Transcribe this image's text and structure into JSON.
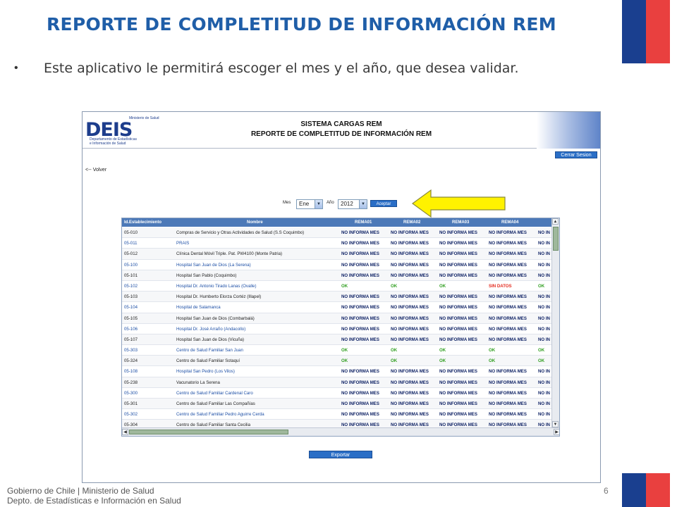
{
  "slide": {
    "title": "REPORTE DE COMPLETITUD DE INFORMACIÓN REM",
    "bullet": "Este aplicativo le permitirá escoger el mes y  el año, que desea validar.",
    "footer_line1": "Gobierno de Chile | Ministerio de Salud",
    "footer_line2": "Depto. de Estadísticas e Información en Salud",
    "page_number": "6",
    "colors": {
      "title": "#1f5ea8",
      "flag_blue": "#1a3f8f",
      "flag_red": "#e9403f"
    }
  },
  "app": {
    "logo": {
      "wordmark": "DEIS",
      "ministry": "Ministerio de Salud",
      "dept_line1": "Departamento de Estadísticas",
      "dept_line2": "e Información de Salud"
    },
    "header_line1": "SISTEMA CARGAS REM",
    "header_line2": "REPORTE DE COMPLETITUD DE INFORMACIÓN REM",
    "logout_label": "Cerrar Sesion",
    "back_label": "<-- Volver",
    "filters": {
      "month_label": "Mes",
      "month_value": "Ene",
      "year_label": "Año",
      "year_value": "2012",
      "accept_label": "Aceptar"
    },
    "table": {
      "columns": [
        "Id.Establecimiento",
        "Nombre",
        "REMA01",
        "REMA02",
        "REMA03",
        "REMA04"
      ],
      "rows": [
        {
          "id": "05-010",
          "name": "Compras de Servicio y Otras Actividades de Salud (S.S Coquimbo)",
          "r1": "NO INFORMA MES",
          "r2": "NO INFORMA MES",
          "r3": "NO INFORMA MES",
          "r4": "NO INFORMA MES",
          "r5": "NO IN"
        },
        {
          "id": "05-011",
          "name": "PRAIS",
          "r1": "NO INFORMA MES",
          "r2": "NO INFORMA MES",
          "r3": "NO INFORMA MES",
          "r4": "NO INFORMA MES",
          "r5": "NO IN"
        },
        {
          "id": "05-012",
          "name": "Clínica Dental Móvil Triple. Pat. PW4100 (Monte Patria)",
          "r1": "NO INFORMA MES",
          "r2": "NO INFORMA MES",
          "r3": "NO INFORMA MES",
          "r4": "NO INFORMA MES",
          "r5": "NO IN"
        },
        {
          "id": "05-100",
          "name": "Hospital San Juan de Dios (La Serena)",
          "r1": "NO INFORMA MES",
          "r2": "NO INFORMA MES",
          "r3": "NO INFORMA MES",
          "r4": "NO INFORMA MES",
          "r5": "NO IN"
        },
        {
          "id": "05-101",
          "name": "Hospital San Pablo (Coquimbo)",
          "r1": "NO INFORMA MES",
          "r2": "NO INFORMA MES",
          "r3": "NO INFORMA MES",
          "r4": "NO INFORMA MES",
          "r5": "NO IN"
        },
        {
          "id": "05-102",
          "name": "Hospital Dr. Antonio Tirado Lanas (Ovalle)",
          "r1": "OK",
          "r2": "OK",
          "r3": "OK",
          "r4": "SIN DATOS",
          "r5": "OK"
        },
        {
          "id": "05-103",
          "name": "Hospital Dr. Humberto Elorza Cortéz (Illapel)",
          "r1": "NO INFORMA MES",
          "r2": "NO INFORMA MES",
          "r3": "NO INFORMA MES",
          "r4": "NO INFORMA MES",
          "r5": "NO IN"
        },
        {
          "id": "05-104",
          "name": "Hospital de Salamanca",
          "r1": "NO INFORMA MES",
          "r2": "NO INFORMA MES",
          "r3": "NO INFORMA MES",
          "r4": "NO INFORMA MES",
          "r5": "NO IN"
        },
        {
          "id": "05-105",
          "name": "Hospital San Juan de Dios (Combarbalá)",
          "r1": "NO INFORMA MES",
          "r2": "NO INFORMA MES",
          "r3": "NO INFORMA MES",
          "r4": "NO INFORMA MES",
          "r5": "NO IN"
        },
        {
          "id": "05-106",
          "name": "Hospital Dr. José Arraño (Andacollo)",
          "r1": "NO INFORMA MES",
          "r2": "NO INFORMA MES",
          "r3": "NO INFORMA MES",
          "r4": "NO INFORMA MES",
          "r5": "NO IN"
        },
        {
          "id": "05-107",
          "name": "Hospital San Juan de Dios (Vicuña)",
          "r1": "NO INFORMA MES",
          "r2": "NO INFORMA MES",
          "r3": "NO INFORMA MES",
          "r4": "NO INFORMA MES",
          "r5": "NO IN"
        },
        {
          "id": "05-303",
          "name": "Centro de Salud Familiar San Juan",
          "r1": "OK",
          "r2": "OK",
          "r3": "OK",
          "r4": "OK",
          "r5": "OK"
        },
        {
          "id": "05-324",
          "name": "Centro de Salud Familiar Sotaquí",
          "r1": "OK",
          "r2": "OK",
          "r3": "OK",
          "r4": "OK",
          "r5": "OK"
        },
        {
          "id": "05-108",
          "name": "Hospital San Pedro (Los Vilos)",
          "r1": "NO INFORMA MES",
          "r2": "NO INFORMA MES",
          "r3": "NO INFORMA MES",
          "r4": "NO INFORMA MES",
          "r5": "NO IN"
        },
        {
          "id": "05-238",
          "name": "Vacunatorio La Serena",
          "r1": "NO INFORMA MES",
          "r2": "NO INFORMA MES",
          "r3": "NO INFORMA MES",
          "r4": "NO INFORMA MES",
          "r5": "NO IN"
        },
        {
          "id": "05-300",
          "name": "Centro de Salud Familiar Cardenal Caro",
          "r1": "NO INFORMA MES",
          "r2": "NO INFORMA MES",
          "r3": "NO INFORMA MES",
          "r4": "NO INFORMA MES",
          "r5": "NO IN"
        },
        {
          "id": "05-301",
          "name": "Centro de Salud Familiar Las Compañías",
          "r1": "NO INFORMA MES",
          "r2": "NO INFORMA MES",
          "r3": "NO INFORMA MES",
          "r4": "NO INFORMA MES",
          "r5": "NO IN"
        },
        {
          "id": "05-302",
          "name": "Centro de Salud Familiar Pedro Aguirre Cerda",
          "r1": "NO INFORMA MES",
          "r2": "NO INFORMA MES",
          "r3": "NO INFORMA MES",
          "r4": "NO INFORMA MES",
          "r5": "NO IN"
        },
        {
          "id": "05-304",
          "name": "Centro de Salud Familiar Santa Cecilia",
          "r1": "NO INFORMA MES",
          "r2": "NO INFORMA MES",
          "r3": "NO INFORMA MES",
          "r4": "NO INFORMA MES",
          "r5": "NO IN"
        }
      ],
      "link_rows": [
        "05-011",
        "05-100",
        "05-102",
        "05-104",
        "05-106",
        "05-303",
        "05-108",
        "05-300",
        "05-302"
      ]
    },
    "export_label": "Exportar",
    "status_colors": {
      "ok": "#2f9e1f",
      "sin_datos": "#e42b1f",
      "no_informa": "#0b1f63"
    },
    "annotation_arrow_color": "#fff200"
  }
}
